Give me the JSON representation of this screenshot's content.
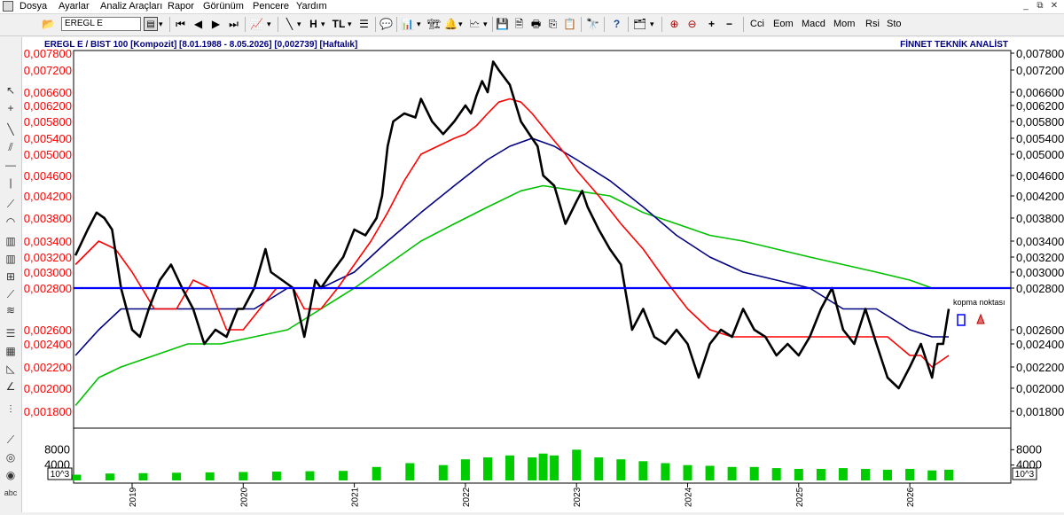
{
  "menubar": {
    "items": [
      "Dosya",
      "Ayarlar",
      "Analiz Araçları",
      "Rapor",
      "Görünüm",
      "Pencere",
      "Yardım"
    ],
    "window_buttons": [
      "_",
      "⧉",
      "✕"
    ]
  },
  "toolbar": {
    "symbol_value": "EREGL E",
    "indicator_buttons": [
      "Cci",
      "Eom",
      "Macd",
      "Mom",
      "Rsi",
      "Sto"
    ]
  },
  "chart": {
    "header_left": "EREGL E / BIST 100 [Kompozit]  [8.01.1988 - 8.05.2026]  [0,002739]  [Haftalık]",
    "header_right": "FİNNET TEKNİK ANALİST",
    "annotation": "kopma noktası",
    "volume_unit": "10^3",
    "colors": {
      "price": "#000000",
      "ma_short": "#ff0000",
      "ma_mid": "#000080",
      "ma_long": "#00c000",
      "horizontal_line": "#0000ff",
      "volume": "#00cc00",
      "left_axis_labels": "#ff0000",
      "header_text": "#000080"
    }
  },
  "chart_data": [
    {
      "type": "line",
      "y_ticks_left": [
        "0,007800",
        "0,007200",
        "0,006600",
        "0,006200",
        "0,005800",
        "0,005400",
        "0,005000",
        "0,004600",
        "0,004200",
        "0,003800",
        "0,003400",
        "0,003200",
        "0,003000",
        "0,002800",
        "0,002600",
        "0,002400",
        "0,002200",
        "0,002000",
        "0,001800"
      ],
      "y_ticks_right": [
        "0,007800",
        "0,007200",
        "0,006600",
        "0,006200",
        "0,005800",
        "0,005400",
        "0,005000",
        "0,004600",
        "0,004200",
        "0,003800",
        "0,003400",
        "0,003200",
        "0,003000",
        "0,002800",
        "0,002600",
        "0,002400",
        "0,002200",
        "0,002000",
        "0,001800"
      ],
      "x_ticks": [
        "2019",
        "2020",
        "2021",
        "2022",
        "2023",
        "2024",
        "2025",
        "2026"
      ],
      "horizontal_line_value": 0.0028,
      "series": [
        {
          "key": "price",
          "x": [
            2018.49,
            2018.6,
            2018.68,
            2018.75,
            2018.82,
            2018.9,
            2019.0,
            2019.07,
            2019.15,
            2019.25,
            2019.35,
            2019.45,
            2019.55,
            2019.65,
            2019.75,
            2019.85,
            2019.95,
            2020.0,
            2020.1,
            2020.2,
            2020.25,
            2020.35,
            2020.45,
            2020.55,
            2020.6,
            2020.65,
            2020.7,
            2020.8,
            2020.9,
            2021.0,
            2021.1,
            2021.2,
            2021.25,
            2021.3,
            2021.35,
            2021.45,
            2021.55,
            2021.6,
            2021.7,
            2021.8,
            2021.9,
            2022.0,
            2022.05,
            2022.1,
            2022.15,
            2022.2,
            2022.25,
            2022.3,
            2022.4,
            2022.5,
            2022.6,
            2022.65,
            2022.7,
            2022.8,
            2022.9,
            2023.0,
            2023.05,
            2023.1,
            2023.2,
            2023.3,
            2023.4,
            2023.5,
            2023.6,
            2023.7,
            2023.8,
            2023.9,
            2024.0,
            2024.1,
            2024.2,
            2024.3,
            2024.4,
            2024.5,
            2024.6,
            2024.7,
            2024.8,
            2024.9,
            2025.0,
            2025.1,
            2025.2,
            2025.3,
            2025.4,
            2025.45,
            2025.5,
            2025.6,
            2025.7,
            2025.8,
            2025.9,
            2026.0,
            2026.1,
            2026.2,
            2026.25,
            2026.3,
            2026.35
          ],
          "y": [
            0.00322,
            0.0036,
            0.0039,
            0.0038,
            0.0036,
            0.0028,
            0.0026,
            0.0025,
            0.0027,
            0.0029,
            0.0031,
            0.0028,
            0.0027,
            0.0024,
            0.0026,
            0.0025,
            0.0027,
            0.0027,
            0.0028,
            0.0033,
            0.003,
            0.0029,
            0.0028,
            0.0025,
            0.0027,
            0.0029,
            0.0028,
            0.003,
            0.0032,
            0.0036,
            0.0035,
            0.0038,
            0.0042,
            0.0052,
            0.0058,
            0.006,
            0.0059,
            0.0064,
            0.0058,
            0.0055,
            0.0058,
            0.0062,
            0.006,
            0.0065,
            0.0069,
            0.0066,
            0.0075,
            0.0072,
            0.0068,
            0.0058,
            0.0054,
            0.0052,
            0.0046,
            0.0044,
            0.0037,
            0.0041,
            0.0043,
            0.004,
            0.0036,
            0.0033,
            0.0031,
            0.0026,
            0.0027,
            0.0025,
            0.0024,
            0.0026,
            0.0024,
            0.0021,
            0.0024,
            0.0026,
            0.0025,
            0.0027,
            0.0026,
            0.0025,
            0.0023,
            0.0024,
            0.0023,
            0.0025,
            0.0027,
            0.0028,
            0.0026,
            0.0025,
            0.0024,
            0.0027,
            0.0024,
            0.0021,
            0.002,
            0.0022,
            0.0024,
            0.0021,
            0.0024,
            0.0024,
            0.0027
          ]
        },
        {
          "key": "ma_short",
          "x": [
            2018.49,
            2018.7,
            2018.85,
            2019.0,
            2019.2,
            2019.4,
            2019.55,
            2019.7,
            2019.85,
            2020.0,
            2020.15,
            2020.3,
            2020.45,
            2020.55,
            2020.7,
            2020.85,
            2021.0,
            2021.15,
            2021.3,
            2021.45,
            2021.6,
            2021.75,
            2021.9,
            2022.0,
            2022.1,
            2022.2,
            2022.3,
            2022.4,
            2022.5,
            2022.6,
            2022.75,
            2022.9,
            2023.0,
            2023.2,
            2023.4,
            2023.6,
            2023.8,
            2024.0,
            2024.2,
            2024.4,
            2024.6,
            2024.8,
            2025.0,
            2025.2,
            2025.4,
            2025.6,
            2025.8,
            2026.0,
            2026.1,
            2026.2,
            2026.35
          ],
          "y": [
            0.0031,
            0.0034,
            0.0033,
            0.003,
            0.0027,
            0.0027,
            0.0029,
            0.0028,
            0.0026,
            0.0026,
            0.0027,
            0.0028,
            0.0028,
            0.0027,
            0.0027,
            0.0028,
            0.0031,
            0.0034,
            0.0039,
            0.0045,
            0.005,
            0.0052,
            0.0054,
            0.0055,
            0.0057,
            0.006,
            0.0063,
            0.0064,
            0.0063,
            0.006,
            0.0055,
            0.005,
            0.0047,
            0.0042,
            0.0037,
            0.0033,
            0.0029,
            0.0027,
            0.0026,
            0.0025,
            0.0025,
            0.0025,
            0.0025,
            0.0025,
            0.0025,
            0.0025,
            0.0025,
            0.0023,
            0.0023,
            0.0022,
            0.0023
          ]
        },
        {
          "key": "ma_mid",
          "x": [
            2018.49,
            2018.7,
            2018.9,
            2019.2,
            2019.5,
            2019.8,
            2020.1,
            2020.4,
            2020.7,
            2021.0,
            2021.3,
            2021.6,
            2021.9,
            2022.2,
            2022.4,
            2022.6,
            2022.8,
            2023.0,
            2023.3,
            2023.6,
            2023.9,
            2024.2,
            2024.5,
            2024.8,
            2025.1,
            2025.4,
            2025.7,
            2026.0,
            2026.2,
            2026.35
          ],
          "y": [
            0.0023,
            0.0026,
            0.0027,
            0.0027,
            0.0027,
            0.0027,
            0.0027,
            0.0028,
            0.0028,
            0.003,
            0.0034,
            0.0039,
            0.0044,
            0.0049,
            0.0052,
            0.0054,
            0.0052,
            0.0049,
            0.0045,
            0.004,
            0.0035,
            0.0032,
            0.003,
            0.0029,
            0.0028,
            0.0027,
            0.0027,
            0.0026,
            0.0025,
            0.0025
          ]
        },
        {
          "key": "ma_long",
          "x": [
            2018.49,
            2018.7,
            2018.9,
            2019.2,
            2019.5,
            2019.8,
            2020.1,
            2020.4,
            2020.7,
            2021.0,
            2021.3,
            2021.6,
            2021.9,
            2022.2,
            2022.5,
            2022.7,
            2023.0,
            2023.3,
            2023.6,
            2023.9,
            2024.2,
            2024.5,
            2024.8,
            2025.1,
            2025.4,
            2025.7,
            2026.0,
            2026.2,
            2026.35
          ],
          "y": [
            0.00185,
            0.0021,
            0.0022,
            0.0023,
            0.0024,
            0.0024,
            0.0025,
            0.0026,
            0.0027,
            0.0028,
            0.0031,
            0.0034,
            0.0037,
            0.004,
            0.0043,
            0.0044,
            0.0043,
            0.0042,
            0.0039,
            0.0037,
            0.0035,
            0.0034,
            0.0033,
            0.0032,
            0.0031,
            0.003,
            0.0029,
            0.0028,
            0.0028
          ]
        }
      ]
    },
    {
      "type": "bar",
      "y_ticks": [
        "8000",
        "4000"
      ],
      "unit": "10^3",
      "series": [
        {
          "key": "volume",
          "x": [
            2018.5,
            2018.8,
            2019.1,
            2019.4,
            2019.7,
            2020.0,
            2020.3,
            2020.6,
            2020.9,
            2021.2,
            2021.5,
            2021.8,
            2022.0,
            2022.2,
            2022.4,
            2022.6,
            2022.7,
            2022.8,
            2023.0,
            2023.2,
            2023.4,
            2023.6,
            2023.8,
            2024.0,
            2024.2,
            2024.4,
            2024.6,
            2024.8,
            2025.0,
            2025.2,
            2025.4,
            2025.6,
            2025.8,
            2026.0,
            2026.2,
            2026.35
          ],
          "values": [
            1500,
            1800,
            1900,
            2000,
            2100,
            2200,
            2300,
            2400,
            2500,
            3500,
            4500,
            4000,
            5500,
            6000,
            6500,
            6000,
            7000,
            6500,
            8000,
            6000,
            5500,
            5000,
            4500,
            4000,
            3800,
            3500,
            3500,
            3200,
            3000,
            3000,
            3200,
            3000,
            2800,
            3000,
            2600,
            2800
          ]
        }
      ]
    }
  ]
}
